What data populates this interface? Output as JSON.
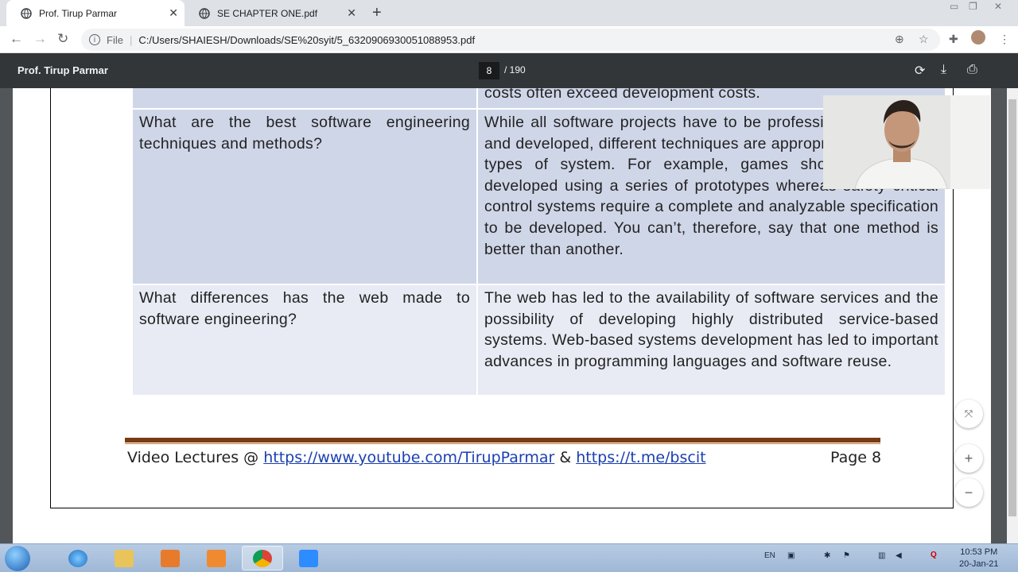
{
  "tabs": [
    {
      "title": "Prof. Tirup Parmar",
      "active": true
    },
    {
      "title": "SE CHAPTER ONE.pdf",
      "active": false
    }
  ],
  "address": {
    "scheme": "File",
    "url": "C:/Users/SHAIESH/Downloads/SE%20syit/5_6320906930051088953.pdf"
  },
  "pdf": {
    "title": "Prof. Tirup Parmar",
    "current_page": "8",
    "total_pages": "/ 190"
  },
  "document": {
    "fragment_top": "costs often exceed development costs.",
    "rows": [
      {
        "question": "What are the best software engineering techniques and methods?",
        "answer": "While all software projects have to be professionally managed and developed, different techniques are appropriate for different types of system. For example, games should always be developed using a series of prototypes whereas safety critical control systems require a complete and analyzable specification to be developed. You can’t, therefore, say that one method is better than another."
      },
      {
        "question": "What differences has the web made to software engineering?",
        "answer": "The web has led to the availability of software services and the possibility of developing highly distributed service-based systems. Web-based systems development has led to important advances in programming languages and software reuse."
      }
    ],
    "footer": {
      "prefix": "Video Lectures @ ",
      "link1": "https://www.youtube.com/TirupParmar",
      "amp": " & ",
      "link2": "https://t.me/bscit",
      "page": "Page 8"
    }
  },
  "zoom": {
    "fit": "fit-to-page",
    "plus": "+",
    "minus": "−"
  },
  "taskbar": {
    "language": "EN",
    "time": "10:53 PM",
    "date": "20-Jan-21"
  },
  "colors": {
    "row_dark": "#cfd6e8",
    "row_light": "#e8ebf4",
    "footer_rule": "#7a3b14",
    "link": "#1a3fb0"
  }
}
